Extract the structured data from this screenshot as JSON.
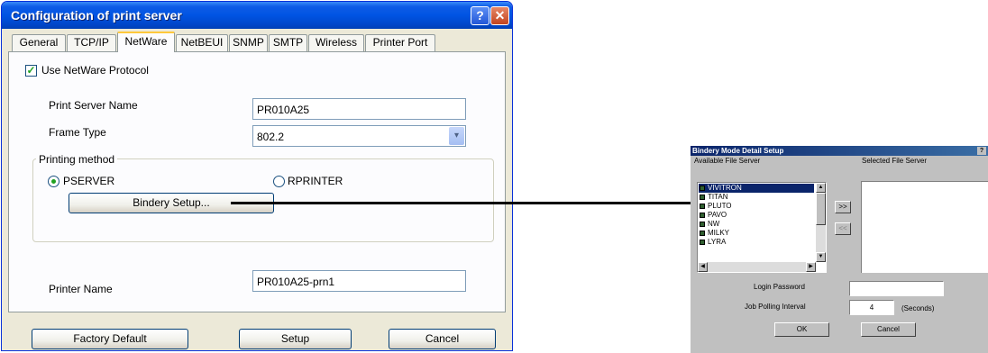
{
  "main_window": {
    "title": "Configuration of print server",
    "help_label": "?",
    "close_label": "✕",
    "tabs": [
      {
        "label": "General"
      },
      {
        "label": "TCP/IP"
      },
      {
        "label": "NetWare",
        "active": true
      },
      {
        "label": "NetBEUI"
      },
      {
        "label": "SNMP"
      },
      {
        "label": "SMTP"
      },
      {
        "label": "Wireless"
      },
      {
        "label": "Printer Port"
      }
    ],
    "use_netware": {
      "label": "Use NetWare Protocol",
      "checked": true,
      "mark": "✓"
    },
    "print_server_name": {
      "label": "Print Server Name",
      "value": "PR010A25"
    },
    "frame_type": {
      "label": "Frame Type",
      "value": "802.2",
      "arrow": "▾"
    },
    "printing_method": {
      "legend": "Printing method",
      "pserver": {
        "label": "PSERVER",
        "selected": true
      },
      "rprinter": {
        "label": "RPRINTER",
        "selected": false
      },
      "bindery_button": "Bindery Setup..."
    },
    "printer_name": {
      "label": "Printer Name",
      "value": "PR010A25-prn1"
    },
    "buttons": {
      "factory_default": "Factory Default",
      "setup": "Setup",
      "cancel": "Cancel"
    }
  },
  "bindery_dialog": {
    "title": "Bindery Mode Detail Setup",
    "help_label": "?",
    "available_label": "Available File Server",
    "selected_label": "Selected File Server",
    "servers": [
      "VIVITRON",
      "TITAN",
      "PLUTO",
      "PAVO",
      "NW",
      "MILKY",
      "LYRA"
    ],
    "selected_server": "VIVITRON",
    "add_button": ">>",
    "remove_button": "<<",
    "scroll_up": "▲",
    "scroll_down": "▼",
    "scroll_left": "◀",
    "scroll_right": "▶",
    "login_password": {
      "label": "Login Password",
      "value": ""
    },
    "job_polling": {
      "label": "Job Polling Interval",
      "value": "4",
      "unit": "(Seconds)"
    },
    "ok_button": "OK",
    "cancel_button": "Cancel"
  },
  "colors": {
    "xp_title": "#0054e3",
    "xp_face": "#ece9d8",
    "win95_face": "#c0c0c0",
    "selection": "#0a246a"
  }
}
